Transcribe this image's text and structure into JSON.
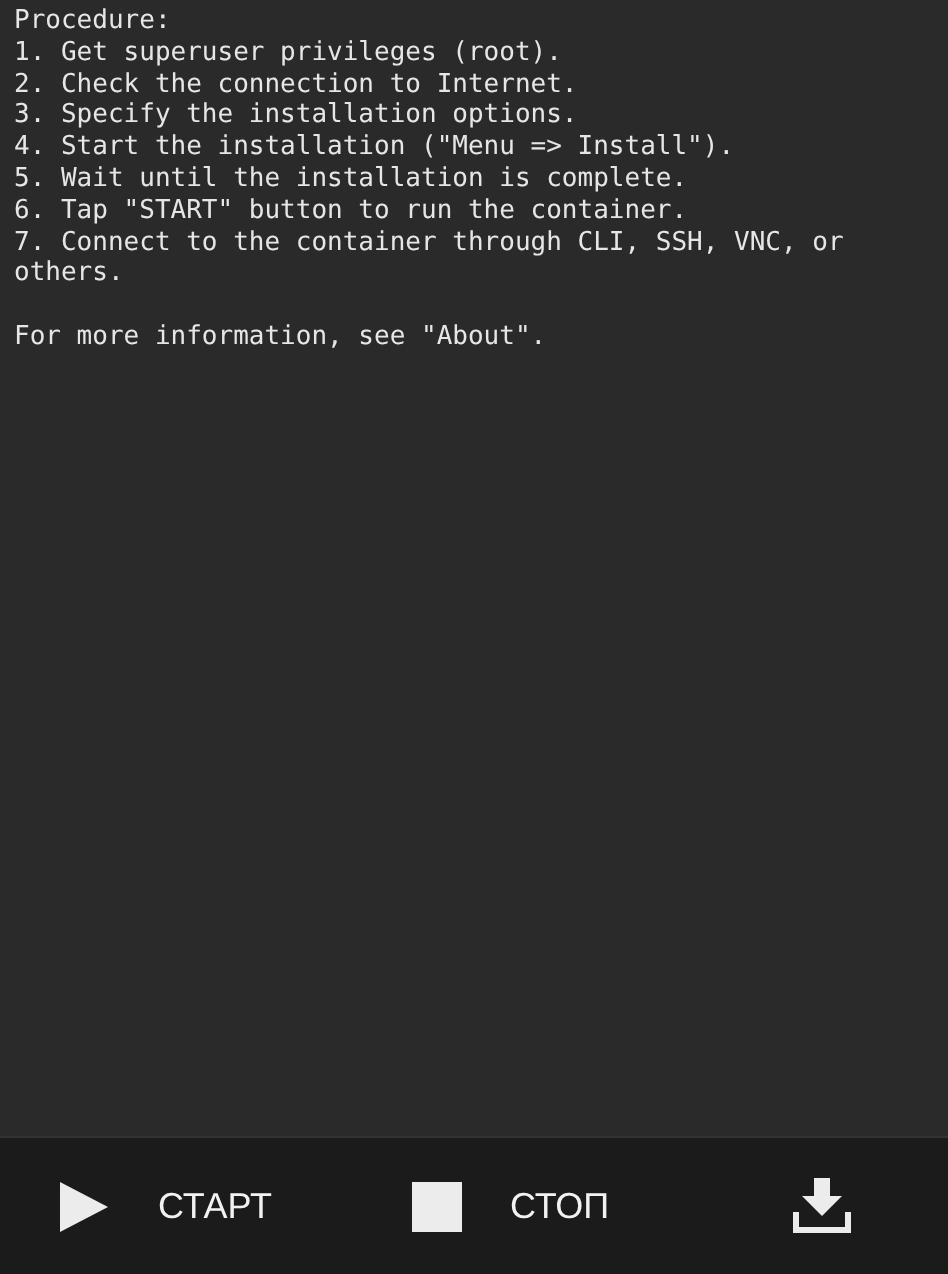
{
  "console": {
    "lines": [
      "Procedure:",
      "1. Get superuser privileges (root).",
      "2. Check the connection to Internet.",
      "3. Specify the installation options.",
      "4. Start the installation (\"Menu => Install\").",
      "5. Wait until the installation is complete.",
      "6. Tap \"START\" button to run the container.",
      "7. Connect to the container through CLI, SSH, VNC, or others."
    ],
    "note": "For more information, see \"About\"."
  },
  "toolbar": {
    "buttons": [
      {
        "kind": "start",
        "label": "СТАРТ"
      },
      {
        "kind": "stop",
        "label": "СТОП"
      },
      {
        "kind": "install"
      }
    ]
  }
}
